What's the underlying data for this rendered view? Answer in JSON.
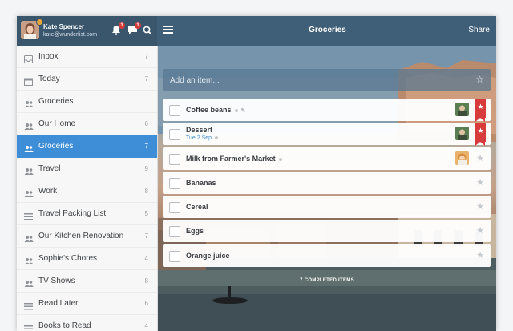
{
  "header": {
    "user_name": "Kate Spencer",
    "user_email": "kate@wunderlist.com",
    "notification_count": "1",
    "comment_count": "1",
    "list_title": "Groceries",
    "share_label": "Share"
  },
  "sidebar": {
    "items": [
      {
        "label": "Inbox",
        "count": "7",
        "icon": "inbox-icon"
      },
      {
        "label": "Today",
        "count": "7",
        "icon": "calendar-icon"
      },
      {
        "label": "Groceries",
        "count": "",
        "icon": "people-icon"
      },
      {
        "label": "Our Home",
        "count": "6",
        "icon": "people-icon"
      },
      {
        "label": "Groceries",
        "count": "7",
        "icon": "people-icon",
        "active": true
      },
      {
        "label": "Travel",
        "count": "9",
        "icon": "people-icon"
      },
      {
        "label": "Work",
        "count": "8",
        "icon": "people-icon"
      },
      {
        "label": "Travel Packing List",
        "count": "5",
        "icon": "list-icon"
      },
      {
        "label": "Our Kitchen Renovation",
        "count": "7",
        "icon": "people-icon"
      },
      {
        "label": "Sophie's Chores",
        "count": "4",
        "icon": "people-icon"
      },
      {
        "label": "TV Shows",
        "count": "8",
        "icon": "people-icon"
      },
      {
        "label": "Read Later",
        "count": "6",
        "icon": "list-icon"
      },
      {
        "label": "Books to Read",
        "count": "4",
        "icon": "list-icon"
      }
    ]
  },
  "main": {
    "add_placeholder": "Add an item...",
    "tasks": [
      {
        "title": "Coffee beans",
        "due": "",
        "starred": true
      },
      {
        "title": "Dessert",
        "due": "Tue 2 Sep",
        "starred": true
      },
      {
        "title": "Milk from Farmer's Market",
        "due": "",
        "starred": false
      },
      {
        "title": "Bananas",
        "due": "",
        "starred": false
      },
      {
        "title": "Cereal",
        "due": "",
        "starred": false
      },
      {
        "title": "Eggs",
        "due": "",
        "starred": false
      },
      {
        "title": "Orange juice",
        "due": "",
        "starred": false
      }
    ],
    "completed_label": "7 COMPLETED ITEMS"
  },
  "colors": {
    "accent": "#3d8ed6",
    "header": "#3f5f78",
    "flag": "#d73b3b"
  }
}
